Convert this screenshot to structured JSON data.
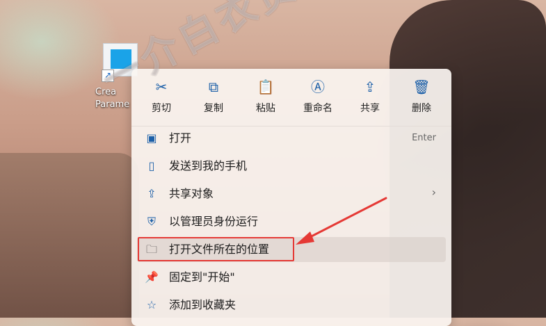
{
  "desktop": {
    "shortcut_label_line1": "Crea",
    "shortcut_label_line2": "Parame"
  },
  "context_menu": {
    "top_actions": [
      {
        "label": "剪切",
        "icon": "scissors-icon"
      },
      {
        "label": "复制",
        "icon": "copy-icon"
      },
      {
        "label": "粘贴",
        "icon": "paste-icon"
      },
      {
        "label": "重命名",
        "icon": "rename-icon"
      },
      {
        "label": "共享",
        "icon": "share-icon"
      },
      {
        "label": "删除",
        "icon": "trash-icon"
      }
    ],
    "items": [
      {
        "label": "打开",
        "hint": "Enter",
        "icon": "open-window-icon"
      },
      {
        "label": "发送到我的手机",
        "icon": "phone-icon"
      },
      {
        "label": "共享对象",
        "icon": "share-icon",
        "submenu_arrow": "›"
      },
      {
        "label": "以管理员身份运行",
        "icon": "admin-shield-icon"
      },
      {
        "label": "打开文件所在的位置",
        "icon": "folder-icon"
      },
      {
        "label": "固定到\"开始\"",
        "icon": "pin-icon"
      },
      {
        "label": "添加到收藏夹",
        "icon": "star-icon"
      }
    ]
  },
  "watermark": "一介白衣资源网"
}
